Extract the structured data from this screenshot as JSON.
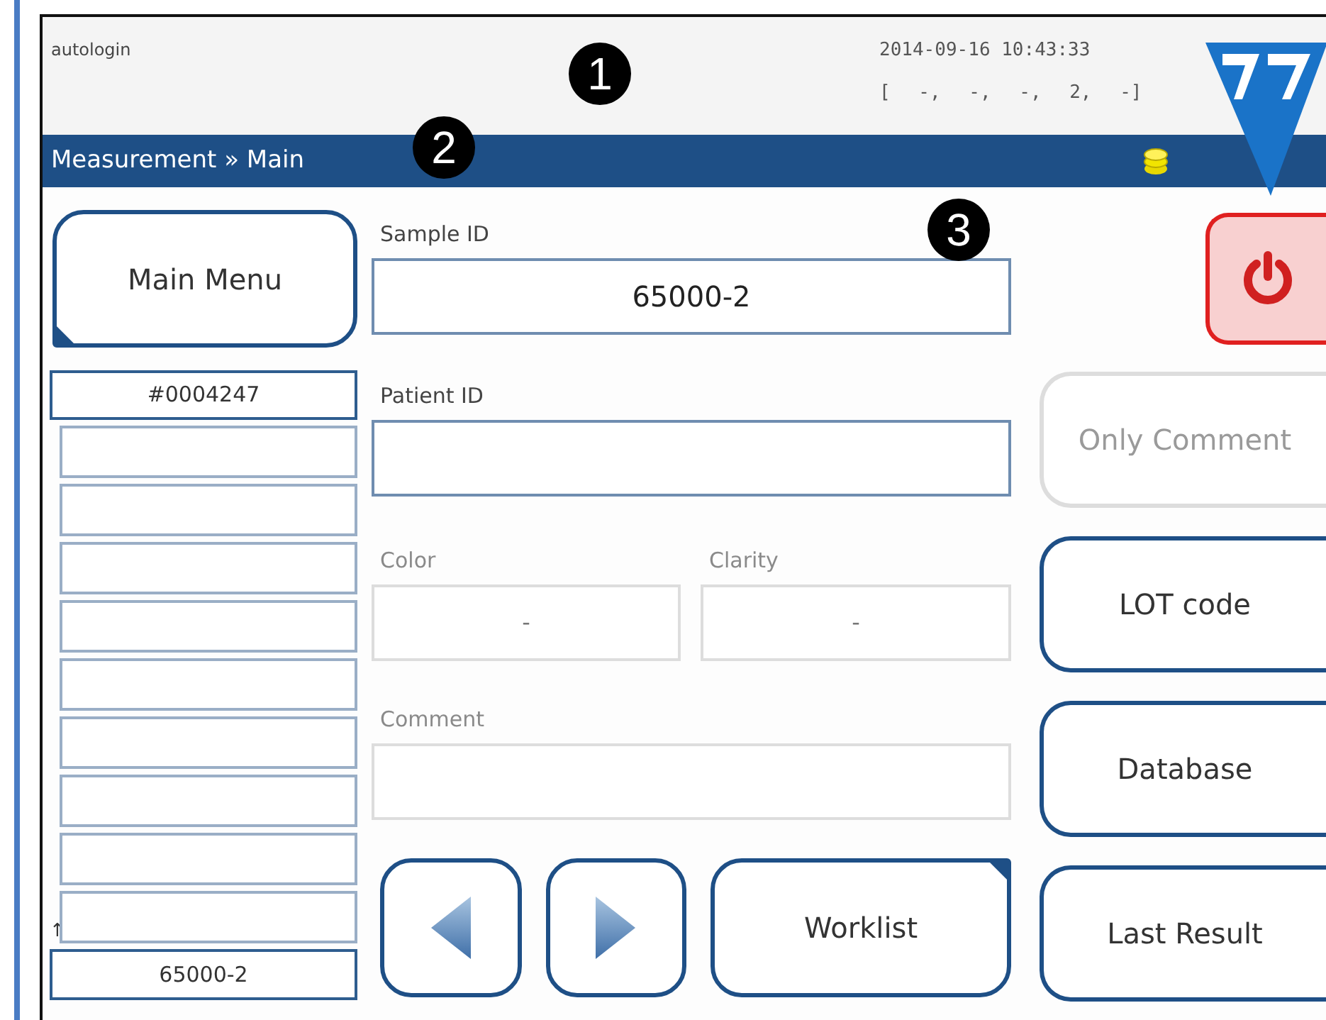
{
  "header": {
    "user": "autologin",
    "datetime": "2014-09-16 10:43:33",
    "status": "[ -, -, -, 2, -]"
  },
  "title_bar": {
    "breadcrumb": "Measurement » Main"
  },
  "main_menu_button": {
    "label": "Main Menu",
    "corner_marked": true
  },
  "sample_list": {
    "header": "#0004247",
    "rows": [
      {},
      {},
      {},
      {},
      {},
      {},
      {},
      {},
      {}
    ],
    "scroll_marker": "↑",
    "footer": "65000-2"
  },
  "fields": [
    {
      "kind": "full",
      "label": "Sample ID",
      "value": "65000-2",
      "disabled": false
    },
    {
      "kind": "full",
      "label": "Patient ID",
      "disabled": false
    },
    {
      "kind": "half",
      "label": "Color",
      "value": "-",
      "disabled": true
    },
    {
      "kind": "half",
      "label": "Clarity",
      "value": "-",
      "disabled": true
    },
    {
      "kind": "full",
      "label": "Comment",
      "disabled": true
    }
  ],
  "nav_buttons": [
    {
      "kind": "back"
    },
    {
      "kind": "forward"
    },
    {
      "kind": "text",
      "label": "Worklist",
      "corner_marked": true
    }
  ],
  "side_buttons": [
    {
      "kind": "power",
      "disabled": false
    },
    {
      "kind": "text",
      "label": "Only Comment",
      "disabled": true
    },
    {
      "kind": "text",
      "label": "LOT code",
      "disabled": false
    },
    {
      "kind": "text",
      "label": "Database",
      "disabled": false
    },
    {
      "kind": "text",
      "label": "Last Result",
      "disabled": false
    }
  ],
  "callouts": [
    "1",
    "2",
    "3"
  ]
}
